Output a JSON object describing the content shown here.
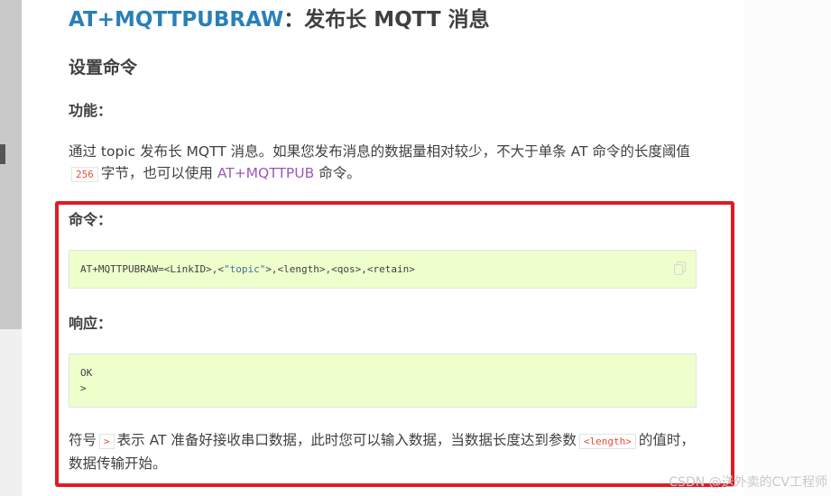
{
  "title": {
    "command": "AT+MQTTPUBRAW",
    "rest": "：发布长 MQTT 消息"
  },
  "section_heading": "设置命令",
  "function_label": "功能：",
  "description": {
    "part1": "通过 topic 发布长 MQTT 消息。如果您发布消息的数据量相对较少，不大于单条 AT 命令的长度阈值",
    "threshold": "256",
    "part2": "字节，也可以使用",
    "link": "AT+MQTTPUB",
    "part3": "命令。"
  },
  "command_label": "命令：",
  "command_code": {
    "prefix": "AT+MQTTPUBRAW=<LinkID>,<",
    "string": "\"topic\"",
    "suffix": ">,<length>,<qos>,<retain>"
  },
  "response_label": "响应：",
  "response_code": {
    "line1": "OK",
    "line2": ">"
  },
  "note": {
    "part1": "符号",
    "symbol": ">",
    "part2": "表示 AT 准备好接收串口数据，此时您可以输入数据，当数据长度达到参数",
    "param": "<length>",
    "part3": "的值时，数据传输开始。"
  },
  "watermark": "CSDN @送外卖的CV工程师",
  "colors": {
    "link_blue": "#2980b9",
    "link_purple": "#9b59b6",
    "code_bg": "#eeffcc",
    "highlight_border": "#e01b24"
  }
}
